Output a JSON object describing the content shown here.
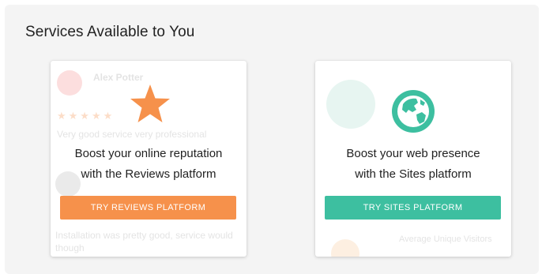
{
  "section": {
    "title": "Services Available to You"
  },
  "cards": [
    {
      "id": "reviews",
      "icon": "star-icon",
      "headline_line1": "Boost your online reputation",
      "headline_line2": "with the Reviews platform",
      "button_label": "TRY REVIEWS PLATFORM",
      "accent_color": "#F6914B",
      "preview": {
        "reviewer_name": "Alex Potter",
        "review_line": "Very good service very professional",
        "second_review_line1": "Installation was pretty good, service would",
        "second_review_line2": "though"
      }
    },
    {
      "id": "sites",
      "icon": "globe-icon",
      "headline_line1": "Boost your web presence",
      "headline_line2": "with the Sites platform",
      "button_label": "TRY SITES PLATFORM",
      "accent_color": "#3DBFA0",
      "preview": {
        "footer_text": "Average Unique Visitors"
      }
    }
  ]
}
